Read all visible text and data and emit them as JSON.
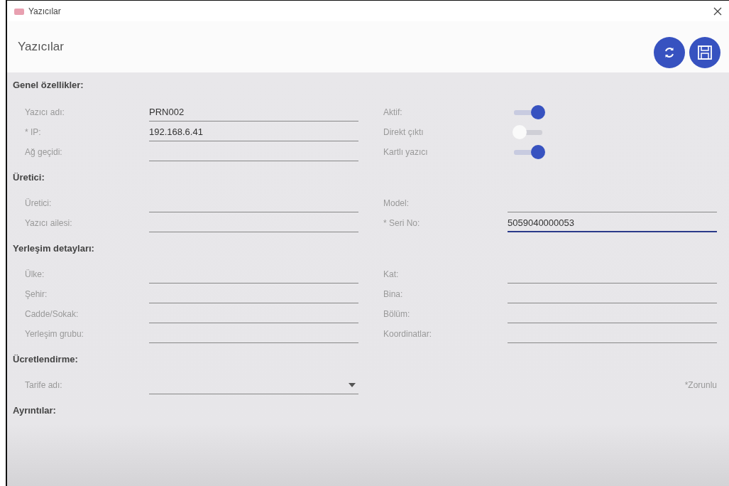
{
  "window": {
    "title": "Yazıcılar"
  },
  "header": {
    "title": "Yazıcılar"
  },
  "sections": [
    {
      "title": "Genel özellikler:",
      "rows": [
        {
          "cells": [
            {
              "kind": "text",
              "label": "Yazıcı adı:",
              "value": "PRN002"
            },
            {
              "kind": "toggle",
              "label": "Aktif:",
              "on": true
            }
          ]
        },
        {
          "cells": [
            {
              "kind": "text",
              "label": "* IP:",
              "value": "192.168.6.41"
            },
            {
              "kind": "toggle",
              "label": "Direkt çıktı",
              "on": false
            }
          ]
        },
        {
          "cells": [
            {
              "kind": "text",
              "label": "Ağ geçidi:"
            },
            {
              "kind": "toggle",
              "label": "Kartlı yazıcı",
              "on": true
            }
          ]
        }
      ]
    },
    {
      "title": "Üretici:",
      "rows": [
        {
          "cells": [
            {
              "kind": "text",
              "label": "Üretici:"
            },
            {
              "kind": "text",
              "label": "Model:"
            }
          ]
        },
        {
          "cells": [
            {
              "kind": "text",
              "label": "Yazıcı ailesi:"
            },
            {
              "kind": "text",
              "label": "* Seri No:",
              "value": "5059040000053",
              "focused": true
            }
          ]
        }
      ]
    },
    {
      "title": "Yerleşim detayları:",
      "rows": [
        {
          "cells": [
            {
              "kind": "text",
              "label": "Ülke:"
            },
            {
              "kind": "text",
              "label": "Kat:"
            }
          ]
        },
        {
          "cells": [
            {
              "kind": "text",
              "label": "Şehir:"
            },
            {
              "kind": "text",
              "label": "Bina:"
            }
          ]
        },
        {
          "cells": [
            {
              "kind": "text",
              "label": "Cadde/Sokak:"
            },
            {
              "kind": "text",
              "label": "Bölüm:"
            }
          ]
        },
        {
          "cells": [
            {
              "kind": "text",
              "label": "Yerleşim grubu:"
            },
            {
              "kind": "text",
              "label": "Koordinatlar:"
            }
          ]
        }
      ]
    },
    {
      "title": "Ücretlendirme:",
      "rows": [
        {
          "cells": [
            {
              "kind": "dropdown",
              "label": "Tarife adı:"
            },
            {
              "kind": "note",
              "text": "*Zorunlu"
            }
          ]
        }
      ]
    },
    {
      "title": "Ayrıntılar:"
    }
  ]
}
